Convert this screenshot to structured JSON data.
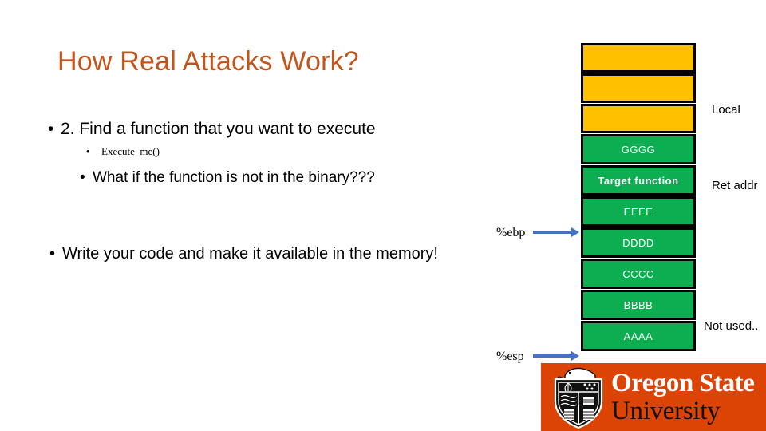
{
  "slide": {
    "title": "How Real Attacks Work?",
    "title_color": "#C3551A",
    "background": "#ffffff"
  },
  "body": {
    "bullet_glyph": "•",
    "items": [
      {
        "level": 1,
        "text": "2. Find a function that you want to execute"
      },
      {
        "level": 2,
        "text": "Execute_me()"
      },
      {
        "level": 2,
        "text": "What if the function is not in the binary???"
      },
      {
        "level": 1,
        "text": "Write your code and make it available in the memory!"
      }
    ]
  },
  "registers": {
    "ebp": {
      "label": "%ebp",
      "arrow_color": "#4472C4"
    },
    "esp": {
      "label": "%esp",
      "arrow_color": "#4472C4"
    }
  },
  "stack": {
    "amber_color": "#FFC000",
    "green_color": "#0DAE51",
    "border_color": "#000000",
    "cells": [
      {
        "text": "",
        "fill": "amber"
      },
      {
        "text": "",
        "fill": "amber"
      },
      {
        "text": "",
        "fill": "amber"
      },
      {
        "text": "GGGG",
        "fill": "green"
      },
      {
        "text": "Target function",
        "fill": "green",
        "emphasis": true
      },
      {
        "text": "EEEE",
        "fill": "green"
      },
      {
        "text": "DDDD",
        "fill": "green"
      },
      {
        "text": "CCCC",
        "fill": "green"
      },
      {
        "text": "BBBB",
        "fill": "green"
      },
      {
        "text": "AAAA",
        "fill": "green"
      }
    ]
  },
  "annotations": {
    "local": "Local",
    "ret_addr": "Ret addr",
    "not_used": "Not used.."
  },
  "logo": {
    "band_color": "#DC4405",
    "line1": "Oregon State",
    "line2": "University",
    "crest_name": "osu-crest-icon"
  }
}
